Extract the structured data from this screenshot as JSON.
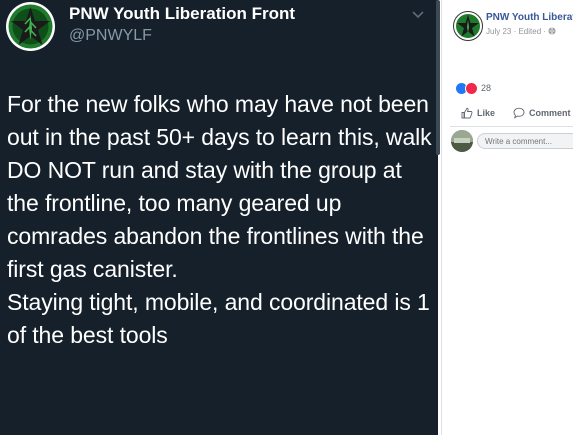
{
  "twitter": {
    "display_name": "PNW Youth Liberation Front",
    "handle": "@PNWYLF",
    "body": "For the new folks who may have not been out in the past 50+ days to learn this, walk DO NOT run and stay with the group at the frontline, too many geared up comrades abandon the frontlines with the first gas canister.\nStaying tight, mobile, and coordinated is 1 of the best tools",
    "icons": {
      "avatar": "star-logo-icon",
      "caret": "chevron-down-icon"
    }
  },
  "facebook": {
    "page_name": "PNW Youth Liberatio",
    "meta": "July 23 · Edited · ",
    "reaction_count": "28",
    "like_label": "Like",
    "comment_label": "Comment",
    "comment_placeholder": "Write a comment...",
    "icons": {
      "globe": "globe-icon",
      "like": "thumbs-up-icon",
      "love": "heart-icon",
      "comment": "speech-bubble-icon"
    }
  },
  "colors": {
    "twitter_bg": "#15202b",
    "twitter_secondary": "#8899a6",
    "facebook_link": "#385898",
    "like_blue": "#2078f4",
    "love_red": "#f0284a"
  }
}
